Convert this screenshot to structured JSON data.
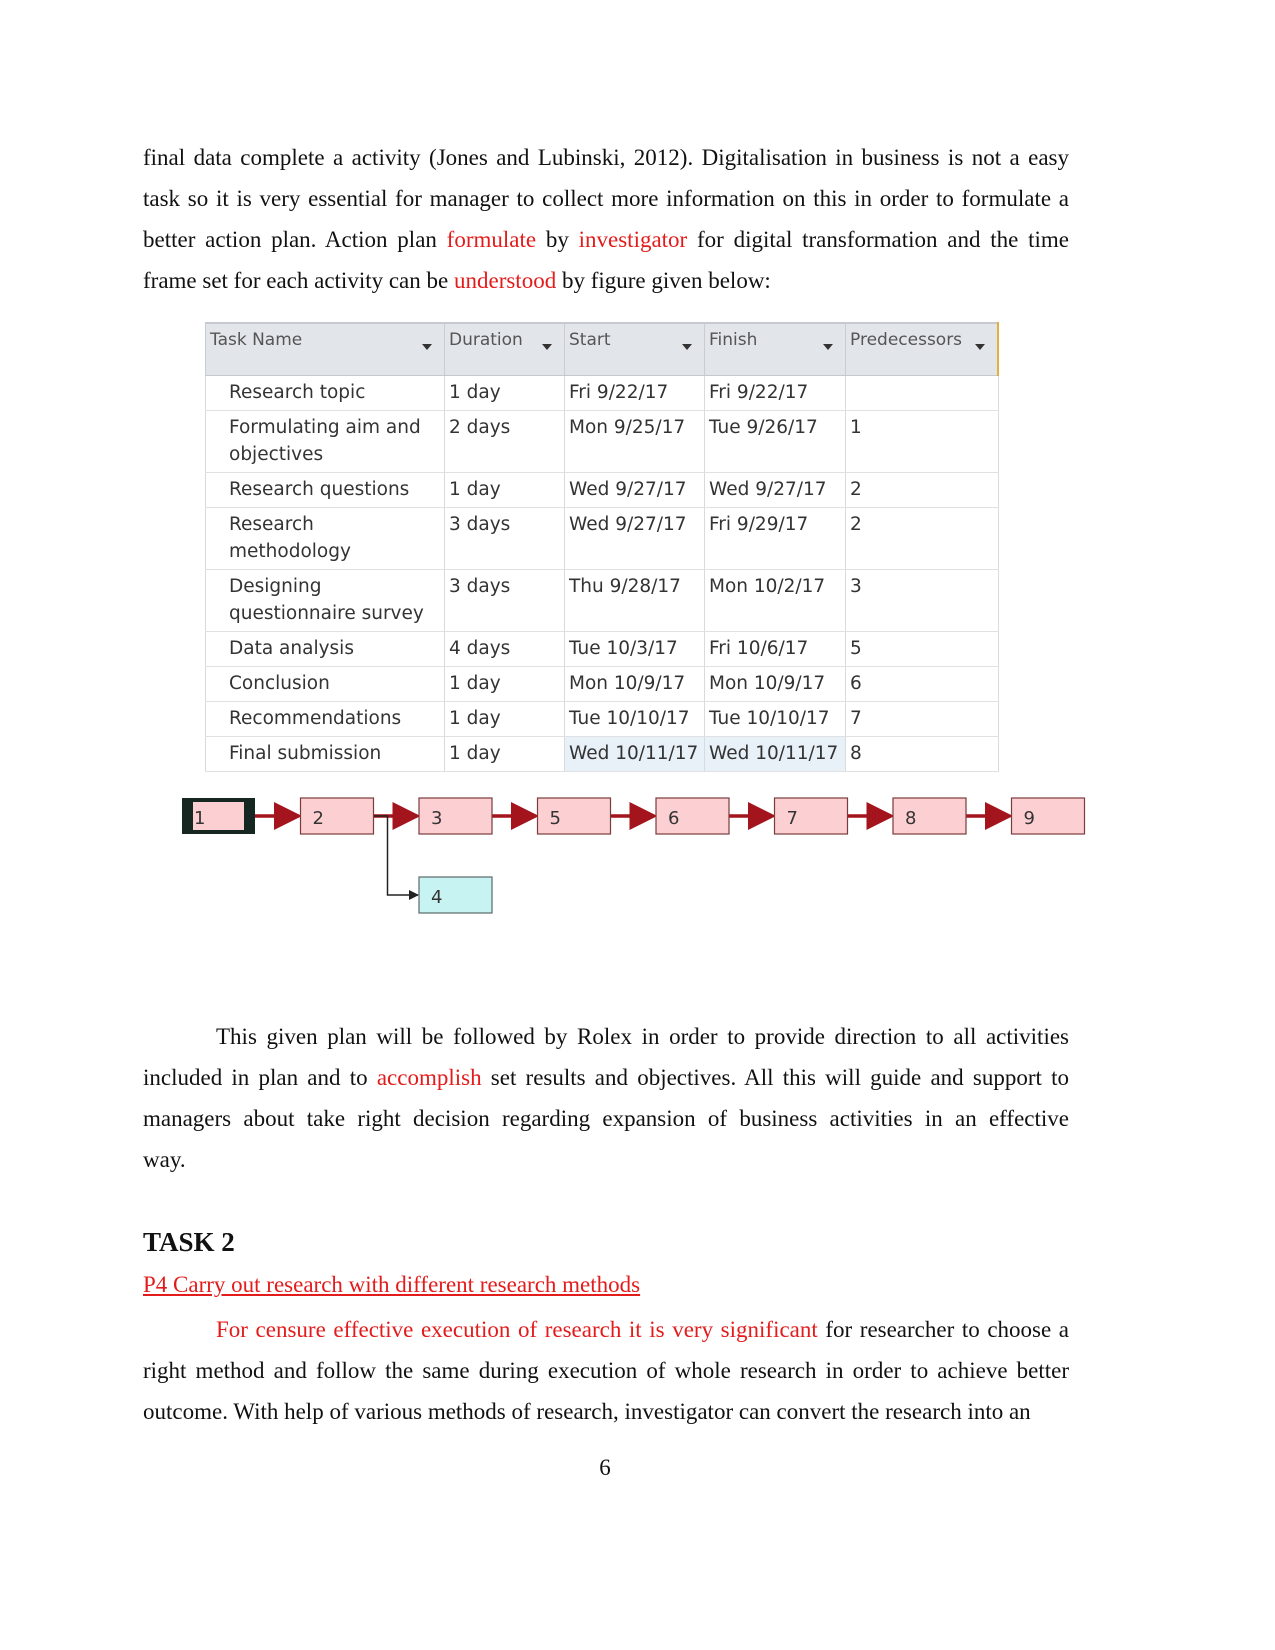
{
  "intro_paragraph": {
    "lines": [
      [
        {
          "t": "final data complete a activity (Jones and Lubinski, 2012). Digitalisation in business is not a easy",
          "red": false
        }
      ],
      [
        {
          "t": "task so it is very essential for manager to collect more information on this in order to formulate a",
          "red": false
        }
      ],
      [
        {
          "t": "better action plan. Action plan ",
          "red": false
        },
        {
          "t": "formulate",
          "red": true
        },
        {
          "t": " by ",
          "red": false
        },
        {
          "t": "investigator",
          "red": true
        },
        {
          "t": " for digital transformation and the time",
          "red": false
        }
      ],
      [
        {
          "t": "frame set for each activity can be ",
          "red": false
        },
        {
          "t": "understood",
          "red": true
        },
        {
          "t": " by figure given below:",
          "red": false
        }
      ]
    ]
  },
  "gantt_table": {
    "headers": [
      "Task Name",
      "Duration",
      "Start",
      "Finish",
      "Predecessors"
    ],
    "rows": [
      {
        "id": 1,
        "name": "Research topic",
        "duration": "1 day",
        "start": "Fri 9/22/17",
        "finish": "Fri 9/22/17",
        "predecessors": ""
      },
      {
        "id": 2,
        "name": "Formulating aim and objectives",
        "duration": "2 days",
        "start": "Mon 9/25/17",
        "finish": "Tue 9/26/17",
        "predecessors": "1"
      },
      {
        "id": 3,
        "name": "Research questions",
        "duration": "1 day",
        "start": "Wed 9/27/17",
        "finish": "Wed 9/27/17",
        "predecessors": "2"
      },
      {
        "id": 4,
        "name": "Research methodology",
        "duration": "3 days",
        "start": "Wed 9/27/17",
        "finish": "Fri 9/29/17",
        "predecessors": "2"
      },
      {
        "id": 5,
        "name": "Designing questionnaire survey",
        "duration": "3 days",
        "start": "Thu 9/28/17",
        "finish": "Mon 10/2/17",
        "predecessors": "3"
      },
      {
        "id": 6,
        "name": "Data analysis",
        "duration": "4 days",
        "start": "Tue 10/3/17",
        "finish": "Fri 10/6/17",
        "predecessors": "5"
      },
      {
        "id": 7,
        "name": "Conclusion",
        "duration": "1 day",
        "start": "Mon 10/9/17",
        "finish": "Mon 10/9/17",
        "predecessors": "6"
      },
      {
        "id": 8,
        "name": "Recommendations",
        "duration": "1 day",
        "start": "Tue 10/10/17",
        "finish": "Tue 10/10/17",
        "predecessors": "7"
      },
      {
        "id": 9,
        "name": "Final submission",
        "duration": "1 day",
        "start": "Wed 10/11/17",
        "finish": "Wed 10/11/17",
        "predecessors": "8",
        "highlight_dates": true
      }
    ]
  },
  "network_diagram": {
    "critical_path": [
      "1",
      "2",
      "3",
      "5",
      "6",
      "7",
      "8",
      "9"
    ],
    "branch": {
      "from": "2",
      "to": "4"
    },
    "colors": {
      "critical_fill": "#fcd0d3",
      "critical_arrow": "#a3141c",
      "noncritical_fill": "#c7f3f3",
      "start_border": "#162620"
    }
  },
  "body_paragraph": {
    "lines": [
      [
        {
          "t": "This given plan will be followed by Rolex in order to provide direction to all activities",
          "red": false
        }
      ],
      [
        {
          "t": "included in plan and to ",
          "red": false
        },
        {
          "t": "accomplish",
          "red": true
        },
        {
          "t": " set results and objectives. All this will guide and support to",
          "red": false
        }
      ],
      [
        {
          "t": "managers about take right decision regarding expansion of business activities in an effective",
          "red": false
        }
      ],
      [
        {
          "t": "way.",
          "red": false
        }
      ]
    ]
  },
  "task_heading": "TASK 2",
  "sub_heading": "P4 Carry out research with different research methods",
  "task_paragraph": {
    "lines": [
      [
        {
          "t": "For censure effective execution of research it is very significant",
          "red": true
        },
        {
          "t": " for researcher to choose a",
          "red": false
        }
      ],
      [
        {
          "t": "right method and follow the same during execution of whole research in order to achieve better",
          "red": false
        }
      ],
      [
        {
          "t": "outcome. With help of various methods of research, investigator can convert the research into an",
          "red": false
        }
      ]
    ]
  },
  "page_number": "6",
  "colors": {
    "accent_red": "#e31b1b"
  }
}
